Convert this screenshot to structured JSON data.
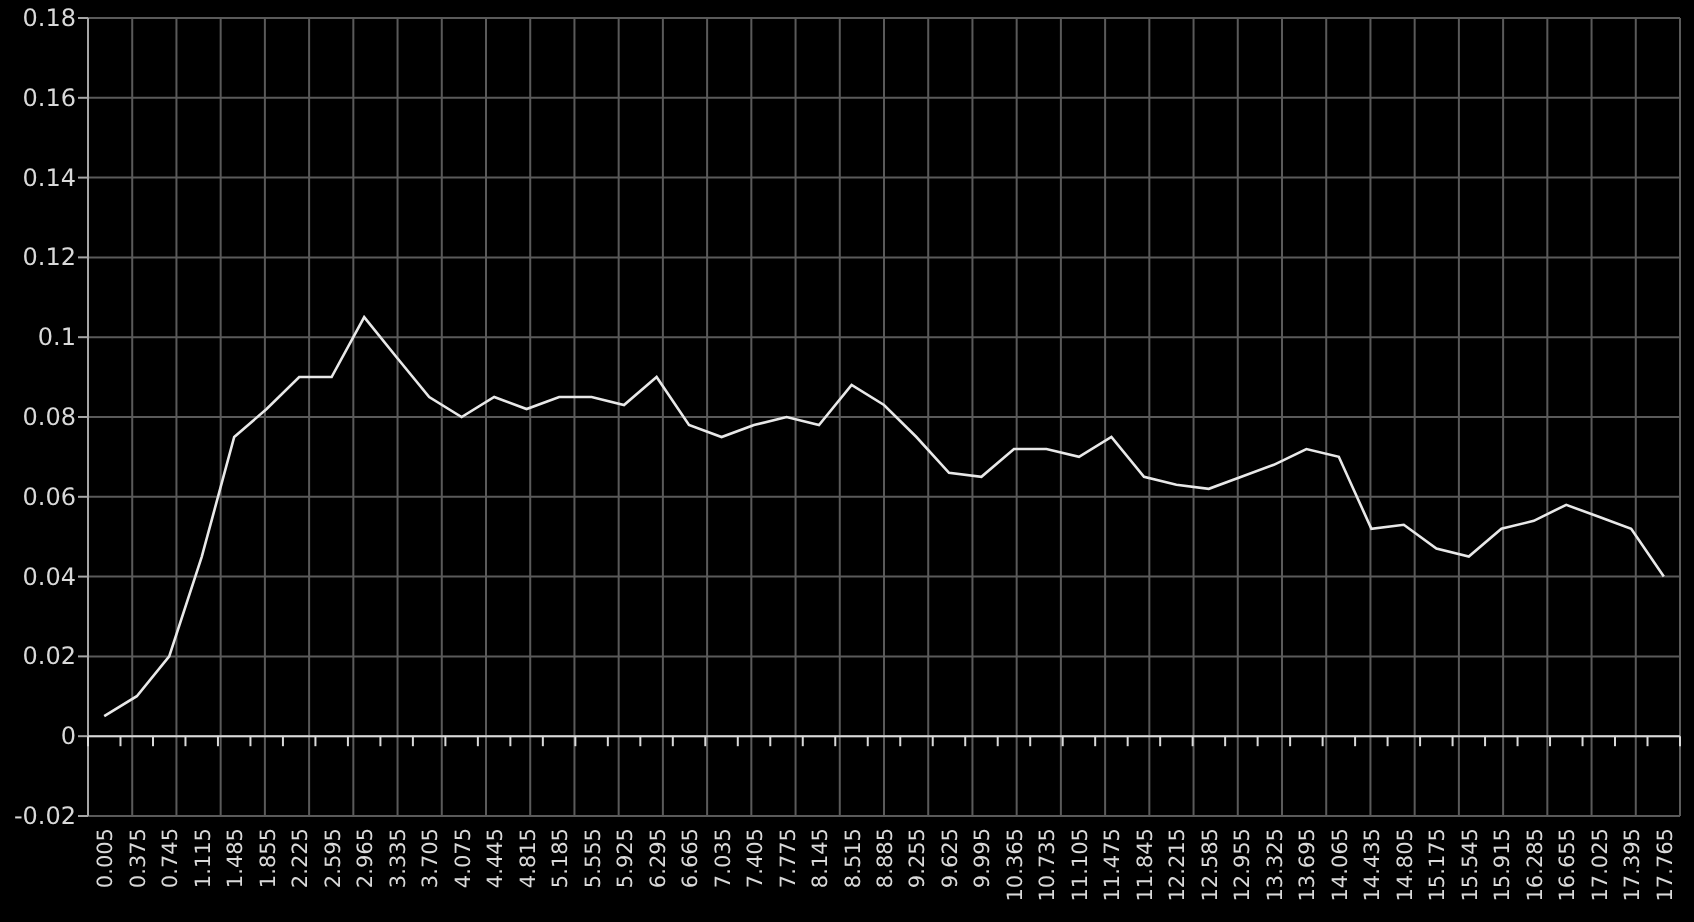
{
  "chart": {
    "chart_data": {
      "type": "line",
      "categories": [
        "0.005",
        "0.375",
        "0.745",
        "1.115",
        "1.485",
        "1.855",
        "2.225",
        "2.595",
        "2.965",
        "3.335",
        "3.705",
        "4.075",
        "4.445",
        "4.815",
        "5.185",
        "5.555",
        "5.925",
        "6.295",
        "6.665",
        "7.035",
        "7.405",
        "7.775",
        "8.145",
        "8.515",
        "8.885",
        "9.255",
        "9.625",
        "9.995",
        "10.365",
        "10.735",
        "11.105",
        "11.475",
        "11.845",
        "12.215",
        "12.585",
        "12.955",
        "13.325",
        "13.695",
        "14.065",
        "14.435",
        "14.805",
        "15.175",
        "15.545",
        "15.915",
        "16.285",
        "16.655",
        "17.025",
        "17.395",
        "17.765"
      ],
      "grid": true,
      "series": [
        {
          "color": "#e8e8e8",
          "values": [
            0.005,
            0.01,
            0.02,
            0.045,
            0.075,
            0.082,
            0.09,
            0.09,
            0.105,
            0.095,
            0.085,
            0.08,
            0.085,
            0.082,
            0.085,
            0.085,
            0.083,
            0.09,
            0.078,
            0.075,
            0.078,
            0.08,
            0.078,
            0.088,
            0.083,
            0.075,
            0.066,
            0.065,
            0.072,
            0.072,
            0.07,
            0.075,
            0.065,
            0.063,
            0.062,
            0.065,
            0.068,
            0.072,
            0.07,
            0.052,
            0.053,
            0.047,
            0.045,
            0.052,
            0.054,
            0.058,
            0.055,
            0.052,
            0.04
          ]
        }
      ],
      "ylim": [
        -0.02,
        0.18
      ],
      "yticks": [
        {
          "value": -0.02,
          "label": "-0.02"
        },
        {
          "value": 0,
          "label": "0"
        },
        {
          "value": 0.02,
          "label": "0.02"
        },
        {
          "value": 0.04,
          "label": "0.04"
        },
        {
          "value": 0.06,
          "label": "0.06"
        },
        {
          "value": 0.08,
          "label": "0.08"
        },
        {
          "value": 0.1,
          "label": "0.1"
        },
        {
          "value": 0.12,
          "label": "0.12"
        },
        {
          "value": 0.14,
          "label": "0.14"
        },
        {
          "value": 0.16,
          "label": "0.16"
        },
        {
          "value": 0.18,
          "label": "0.18"
        }
      ]
    }
  }
}
